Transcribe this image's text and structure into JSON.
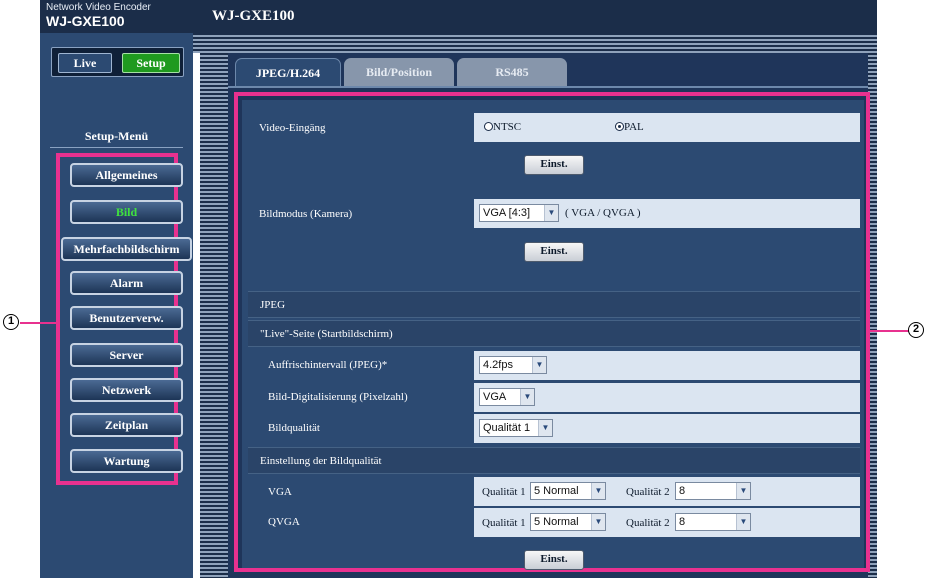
{
  "header": {
    "brand_sub": "Network Video Encoder",
    "brand_main": "WJ-GXE100",
    "app_title": "WJ-GXE100"
  },
  "mode": {
    "live_label": "Live",
    "setup_label": "Setup"
  },
  "sidebar": {
    "menu_title": "Setup-Menü",
    "items": [
      {
        "label": "Allgemeines",
        "active": false
      },
      {
        "label": "Bild",
        "active": true
      },
      {
        "label": "Mehrfachbildschirm",
        "active": false
      },
      {
        "label": "Alarm",
        "active": false
      },
      {
        "label": "Benutzerverw.",
        "active": false
      },
      {
        "label": "Server",
        "active": false
      },
      {
        "label": "Netzwerk",
        "active": false
      },
      {
        "label": "Zeitplan",
        "active": false
      },
      {
        "label": "Wartung",
        "active": false
      }
    ]
  },
  "tabs": [
    {
      "label": "JPEG/H.264",
      "active": true
    },
    {
      "label": "Bild/Position",
      "active": false
    },
    {
      "label": "RS485",
      "active": false
    }
  ],
  "video_input": {
    "label": "Video-Eingäng",
    "option_ntsc": "NTSC",
    "option_pal": "PAL",
    "selected": "PAL"
  },
  "image_mode": {
    "label": "Bildmodus (Kamera)",
    "value": "VGA [4:3]",
    "hint": "( VGA / QVGA )"
  },
  "set_button_label": "Einst.",
  "jpeg": {
    "section_title": "JPEG",
    "live_page_title": "\"Live\"-Seite (Startbildschirm)",
    "refresh_label": "Auffrischintervall (JPEG)*",
    "refresh_value": "4.2fps",
    "digitization_label": "Bild-Digitalisierung (Pixelzahl)",
    "digitization_value": "VGA",
    "quality_label": "Bildqualität",
    "quality_value": "Qualität 1",
    "quality_settings_title": "Einstellung der Bildqualität",
    "rows": [
      {
        "label": "VGA",
        "q1_label": "Qualität 1",
        "q1_value": "5 Normal",
        "q2_label": "Qualität 2",
        "q2_value": "8"
      },
      {
        "label": "QVGA",
        "q1_label": "Qualität 1",
        "q1_value": "5 Normal",
        "q2_label": "Qualität 2",
        "q2_value": "8"
      }
    ]
  },
  "callouts": {
    "menu": "1",
    "panel": "2"
  },
  "colors": {
    "header_navy": "#1b2d49",
    "panel_blue": "#2c4a72",
    "highlight_magenta": "#e8318f",
    "active_green": "#1f9a1f"
  }
}
